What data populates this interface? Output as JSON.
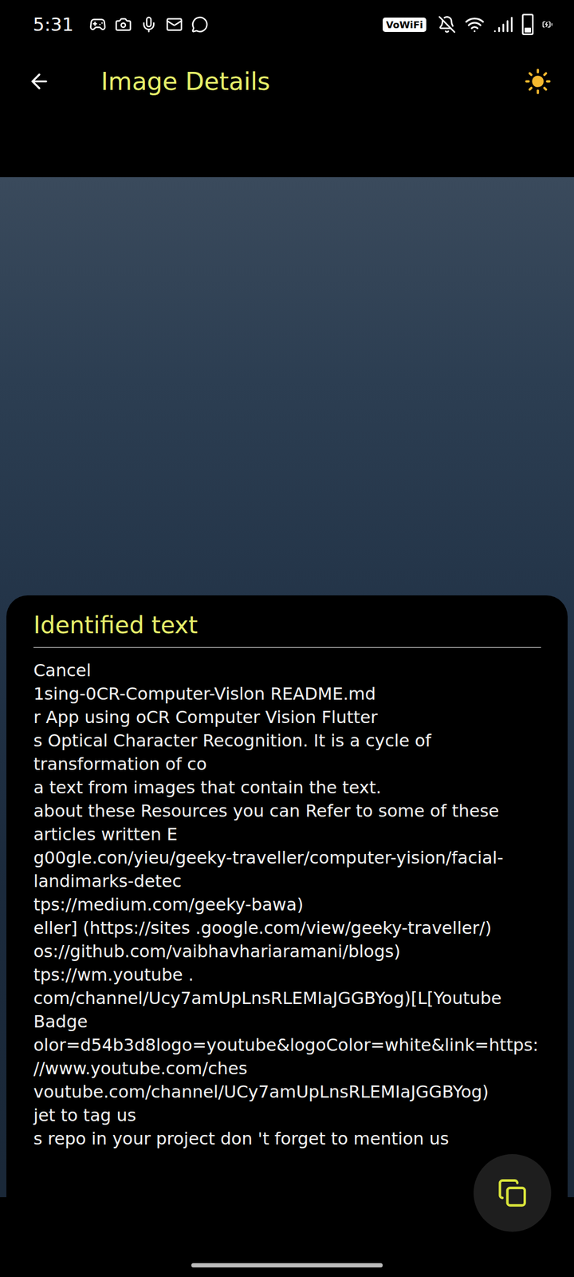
{
  "status_bar": {
    "time": "5:31",
    "badge": "VoWiFi",
    "battery": {
      "level": 0.3,
      "charging": true
    }
  },
  "app_bar": {
    "title": "Image Details"
  },
  "panel": {
    "title": "Identified text",
    "lines": [
      "Cancel",
      "1sing-0CR-Computer-Vislon README.md",
      "r App using oCR Computer Vision Flutter",
      "s Optical Character Recognition. It is a cycle of transformation of co",
      "a text from images that contain the text.",
      "about these Resources you can Refer to some of these articles written E",
      "g00gle.con/yieu/geeky-traveller/computer-yision/facial-landimarks-detec",
      "tps://medium.com/geeky-bawa)",
      "eller] (https://sites .google.com/view/geeky-traveller/)",
      "os://github.com/vaibhavhariaramani/blogs)",
      "tps://wm.youtube . com/channel/Ucy7amUpLnsRLEMIaJGGBYog)[L[Youtube Badge",
      "olor=d54b3d8logo=youtube&logoColor=white&link=https://www.youtube.com/ches",
      "voutube.com/channel/UCy7amUpLnsRLEMIaJGGBYog)",
      "jet to tag us",
      "s repo in your project don 't forget to mention us"
    ]
  }
}
